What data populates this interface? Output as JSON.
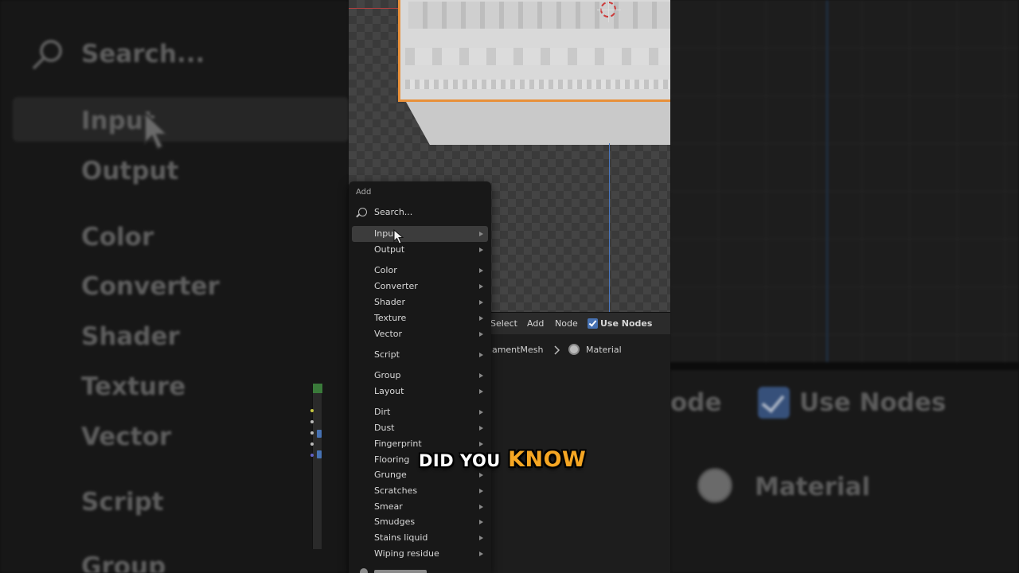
{
  "left_panel": {
    "search": "Search...",
    "items": [
      "Input",
      "Output",
      "Color",
      "Converter",
      "Shader",
      "Texture",
      "Vector",
      "Script",
      "Group"
    ]
  },
  "right_panel": {
    "node_text": "ode",
    "use_nodes": "Use Nodes",
    "material": "Material"
  },
  "header": {
    "select": "Select",
    "add": "Add",
    "node": "Node",
    "use_nodes": "Use Nodes",
    "use_nodes_checked": true
  },
  "breadcrumb": {
    "object": "OrnamentMesh",
    "material": "Material"
  },
  "menu": {
    "title": "Add",
    "search": "Search...",
    "items": [
      {
        "label": "Input"
      },
      {
        "label": "Output"
      },
      {
        "label": "Color"
      },
      {
        "label": "Converter"
      },
      {
        "label": "Shader"
      },
      {
        "label": "Texture"
      },
      {
        "label": "Vector"
      },
      {
        "label": "Script"
      },
      {
        "label": "Group"
      },
      {
        "label": "Layout"
      },
      {
        "label": "Dirt"
      },
      {
        "label": "Dust"
      },
      {
        "label": "Fingerprint"
      },
      {
        "label": "Flooring"
      },
      {
        "label": "Grunge"
      },
      {
        "label": "Scratches"
      },
      {
        "label": "Smear"
      },
      {
        "label": "Smudges"
      },
      {
        "label": "Stains liquid"
      },
      {
        "label": "Wiping residue"
      }
    ],
    "highlighted": "Input"
  },
  "caption": {
    "part1": "DID YOU",
    "part2": "KNOW"
  },
  "colors": {
    "accent_orange": "#f5a623",
    "checkbox_blue": "#4772b3",
    "selection_outline": "#e8903a"
  }
}
